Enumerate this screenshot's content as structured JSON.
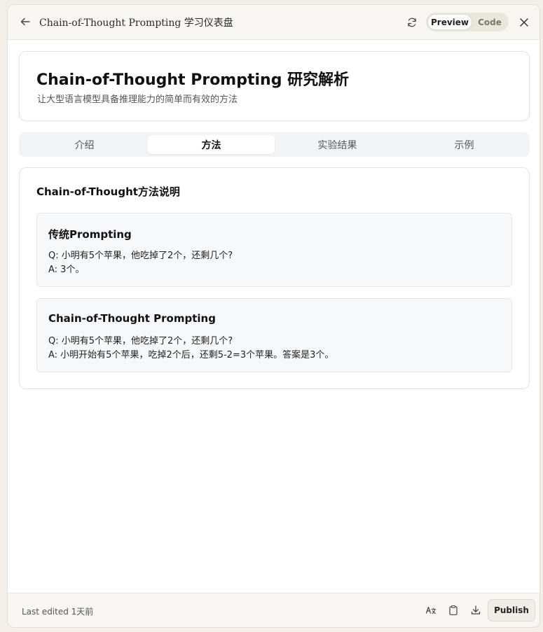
{
  "app": {
    "title": "Chain-of-Thought Prompting 学习仪表盘",
    "toggle": {
      "preview": "Preview",
      "code": "Code",
      "selected": "Preview"
    }
  },
  "hero": {
    "title": "Chain-of-Thought Prompting 研究解析",
    "subtitle": "让大型语言模型具备推理能力的简单而有效的方法"
  },
  "tabs": [
    {
      "label": "介绍",
      "active": false
    },
    {
      "label": "方法",
      "active": true
    },
    {
      "label": "实验结果",
      "active": false
    },
    {
      "label": "示例",
      "active": false
    }
  ],
  "method": {
    "title": "Chain-of-Thought方法说明",
    "examples": [
      {
        "title": "传统Prompting",
        "q": "Q: 小明有5个苹果，他吃掉了2个，还剩几个?",
        "a": "A: 3个。"
      },
      {
        "title": "Chain-of-Thought Prompting",
        "q": "Q: 小明有5个苹果，他吃掉了2个，还剩几个?",
        "a": "A: 小明开始有5个苹果，吃掉2个后，还剩5-2=3个苹果。答案是3个。"
      }
    ]
  },
  "footer": {
    "last_edited": "Last edited 1天前",
    "publish": "Publish"
  },
  "icons": {
    "back": "arrow-left-icon",
    "refresh": "refresh-icon",
    "close": "close-icon",
    "translate": "translate-icon",
    "clipboard": "clipboard-icon",
    "download": "download-icon"
  }
}
